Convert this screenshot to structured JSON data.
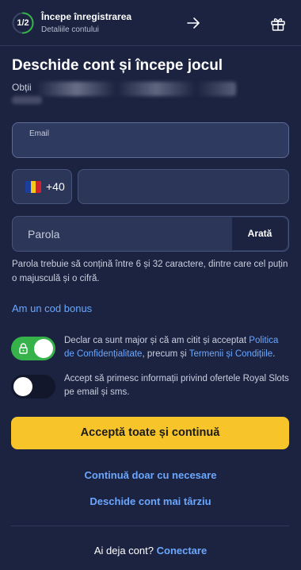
{
  "header": {
    "step": "1/2",
    "title": "Începe înregistrarea",
    "subtitle": "Detaliile contului",
    "icons": [
      "arrow-right-icon",
      "gift-icon"
    ],
    "progress": 0.5,
    "progress_color": "#35b34a"
  },
  "main": {
    "title": "Deschide cont și începe jocul",
    "subtitle_visible": "Obții"
  },
  "form": {
    "email_label": "Email",
    "phone_prefix": "+40",
    "phone_flag": "romania-flag-icon",
    "password_placeholder": "Parola",
    "show_password": "Arată",
    "password_hint": "Parola trebuie să conțină între 6 și 32 caractere, dintre care cel puțin o majusculă și o cifră.",
    "bonus_link": "Am un cod bonus"
  },
  "consents": {
    "terms": {
      "text_before": "Declar ca sunt major și că am citit și acceptat ",
      "privacy_link": "Politica de Confidențialitate",
      "text_middle": ", precum și ",
      "terms_link": "Termenii și Condițiile",
      "text_after": ".",
      "checked": true,
      "locked": true
    },
    "marketing": {
      "text": "Accept să primesc informații privind ofertele Royal Slots pe email și sms.",
      "checked": false
    }
  },
  "actions": {
    "accept_all": "Acceptă toate și continuă",
    "essential_only": "Continuă doar cu necesare",
    "later": "Deschide cont mai târziu",
    "login_prompt": "Ai deja cont?",
    "login_link": "Conectare"
  },
  "colors": {
    "background": "#1b2340",
    "accent_yellow": "#f7c42a",
    "link_blue": "#6ba7ff",
    "toggle_on": "#35b34a"
  }
}
